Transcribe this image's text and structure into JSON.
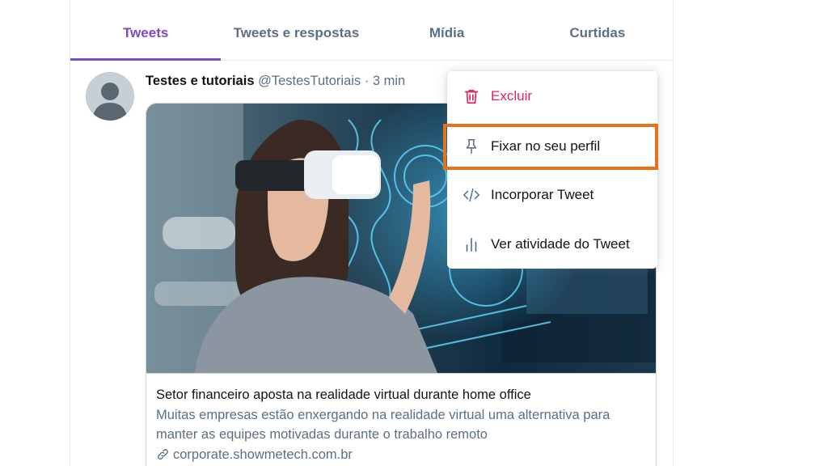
{
  "tabs": [
    {
      "label": "Tweets",
      "active": true
    },
    {
      "label": "Tweets e respostas",
      "active": false
    },
    {
      "label": "Mídia",
      "active": false
    },
    {
      "label": "Curtidas",
      "active": false
    }
  ],
  "tweet": {
    "author_name": "Testes e tutoriais",
    "handle": "@TestesTutoriais",
    "separator": "·",
    "time": "3 min"
  },
  "card": {
    "title": "Setor financeiro aposta na realidade virtual durante home office",
    "description": "Muitas empresas estão enxergando na realidade virtual uma alternativa para manter as equipes motivadas durante o trabalho remoto",
    "link": "corporate.showmetech.com.br",
    "link_icon": "link-icon"
  },
  "menu": {
    "items": [
      {
        "label": "Excluir",
        "icon": "trash-icon",
        "color": "#e0245e"
      },
      {
        "label": "Fixar no seu perfil",
        "icon": "pin-icon",
        "highlighted": true
      },
      {
        "label": "Incorporar Tweet",
        "icon": "code-icon"
      },
      {
        "label": "Ver atividade do Tweet",
        "icon": "bar-chart-icon"
      }
    ]
  },
  "colors": {
    "accent": "#794bc4",
    "danger": "#e0245e",
    "highlight": "#e5731c",
    "secondary_text": "#5b7083"
  }
}
